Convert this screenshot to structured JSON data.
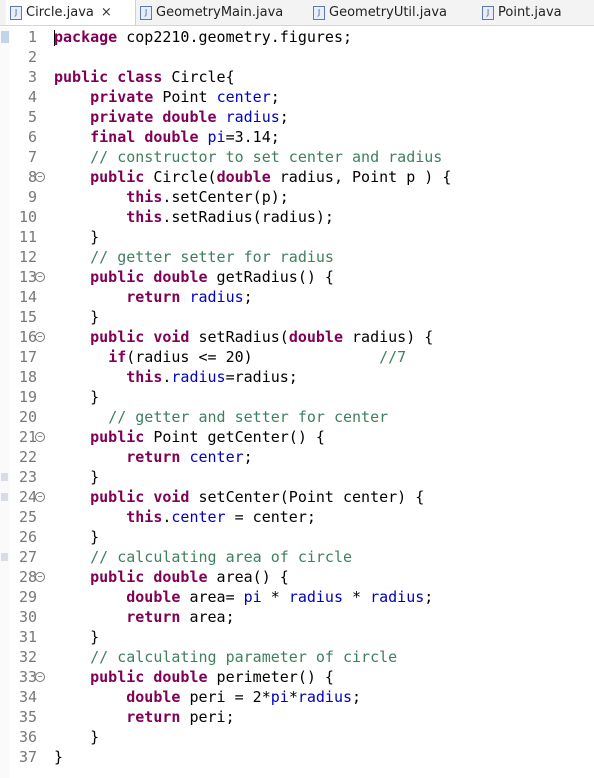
{
  "tabs": [
    {
      "label": "Circle.java",
      "active": true,
      "close": "×",
      "icon": "java-file-icon"
    },
    {
      "label": "GeometryMain.java",
      "active": false,
      "icon": "java-file-icon"
    },
    {
      "label": "GeometryUtil.java",
      "active": false,
      "icon": "java-file-icon"
    },
    {
      "label": "Point.java",
      "active": false,
      "icon": "java-file-icon"
    }
  ],
  "colors": {
    "keyword": "#7f0055",
    "field": "#0000c0",
    "comment": "#3f7f5f",
    "line_number": "#787878"
  },
  "code_lines": [
    {
      "n": "1",
      "fold": false,
      "tokens": [
        {
          "t": "kw",
          "v": "package"
        },
        {
          "t": "",
          "v": " cop2210.geometry.figures;"
        }
      ]
    },
    {
      "n": "2",
      "fold": false,
      "tokens": []
    },
    {
      "n": "3",
      "fold": false,
      "tokens": [
        {
          "t": "kw",
          "v": "public"
        },
        {
          "t": "",
          "v": " "
        },
        {
          "t": "kw",
          "v": "class"
        },
        {
          "t": "",
          "v": " Circle{"
        }
      ]
    },
    {
      "n": "4",
      "fold": false,
      "tokens": [
        {
          "t": "",
          "v": "    "
        },
        {
          "t": "kw",
          "v": "private"
        },
        {
          "t": "",
          "v": " Point "
        },
        {
          "t": "fld",
          "v": "center"
        },
        {
          "t": "",
          "v": ";"
        }
      ]
    },
    {
      "n": "5",
      "fold": false,
      "tokens": [
        {
          "t": "",
          "v": "    "
        },
        {
          "t": "kw",
          "v": "private"
        },
        {
          "t": "",
          "v": " "
        },
        {
          "t": "kw",
          "v": "double"
        },
        {
          "t": "",
          "v": " "
        },
        {
          "t": "fld",
          "v": "radius"
        },
        {
          "t": "",
          "v": ";"
        }
      ]
    },
    {
      "n": "6",
      "fold": false,
      "tokens": [
        {
          "t": "",
          "v": "    "
        },
        {
          "t": "kw",
          "v": "final"
        },
        {
          "t": "",
          "v": " "
        },
        {
          "t": "kw",
          "v": "double"
        },
        {
          "t": "",
          "v": " "
        },
        {
          "t": "fld",
          "v": "pi"
        },
        {
          "t": "",
          "v": "=3.14;"
        }
      ]
    },
    {
      "n": "7",
      "fold": false,
      "tokens": [
        {
          "t": "",
          "v": "    "
        },
        {
          "t": "cm",
          "v": "// constructor to set center and radius"
        }
      ]
    },
    {
      "n": "8",
      "fold": true,
      "tokens": [
        {
          "t": "",
          "v": "    "
        },
        {
          "t": "kw",
          "v": "public"
        },
        {
          "t": "",
          "v": " Circle("
        },
        {
          "t": "kw",
          "v": "double"
        },
        {
          "t": "",
          "v": " radius, Point p ) {"
        }
      ]
    },
    {
      "n": "9",
      "fold": false,
      "tokens": [
        {
          "t": "",
          "v": "        "
        },
        {
          "t": "kw",
          "v": "this"
        },
        {
          "t": "",
          "v": ".setCenter(p);"
        }
      ]
    },
    {
      "n": "10",
      "fold": false,
      "tokens": [
        {
          "t": "",
          "v": "        "
        },
        {
          "t": "kw",
          "v": "this"
        },
        {
          "t": "",
          "v": ".setRadius(radius);"
        }
      ]
    },
    {
      "n": "11",
      "fold": false,
      "tokens": [
        {
          "t": "",
          "v": "    }"
        }
      ]
    },
    {
      "n": "12",
      "fold": false,
      "tokens": [
        {
          "t": "",
          "v": "    "
        },
        {
          "t": "cm",
          "v": "// getter setter for radius"
        }
      ]
    },
    {
      "n": "13",
      "fold": true,
      "tokens": [
        {
          "t": "",
          "v": "    "
        },
        {
          "t": "kw",
          "v": "public"
        },
        {
          "t": "",
          "v": " "
        },
        {
          "t": "kw",
          "v": "double"
        },
        {
          "t": "",
          "v": " getRadius() {"
        }
      ]
    },
    {
      "n": "14",
      "fold": false,
      "tokens": [
        {
          "t": "",
          "v": "        "
        },
        {
          "t": "kw",
          "v": "return"
        },
        {
          "t": "",
          "v": " "
        },
        {
          "t": "fld",
          "v": "radius"
        },
        {
          "t": "",
          "v": ";"
        }
      ]
    },
    {
      "n": "15",
      "fold": false,
      "tokens": [
        {
          "t": "",
          "v": "    }"
        }
      ]
    },
    {
      "n": "16",
      "fold": true,
      "tokens": [
        {
          "t": "",
          "v": "    "
        },
        {
          "t": "kw",
          "v": "public"
        },
        {
          "t": "",
          "v": " "
        },
        {
          "t": "kw",
          "v": "void"
        },
        {
          "t": "",
          "v": " setRadius("
        },
        {
          "t": "kw",
          "v": "double"
        },
        {
          "t": "",
          "v": " radius) {"
        }
      ]
    },
    {
      "n": "17",
      "fold": false,
      "tokens": [
        {
          "t": "",
          "v": "      "
        },
        {
          "t": "kw",
          "v": "if"
        },
        {
          "t": "",
          "v": "(radius <= 20)              "
        },
        {
          "t": "cm",
          "v": "//7"
        }
      ]
    },
    {
      "n": "18",
      "fold": false,
      "tokens": [
        {
          "t": "",
          "v": "        "
        },
        {
          "t": "kw",
          "v": "this"
        },
        {
          "t": "",
          "v": "."
        },
        {
          "t": "fld",
          "v": "radius"
        },
        {
          "t": "",
          "v": "=radius;"
        }
      ]
    },
    {
      "n": "19",
      "fold": false,
      "tokens": [
        {
          "t": "",
          "v": "    }"
        }
      ]
    },
    {
      "n": "20",
      "fold": false,
      "tokens": [
        {
          "t": "",
          "v": "      "
        },
        {
          "t": "cm",
          "v": "// getter and setter for center"
        }
      ]
    },
    {
      "n": "21",
      "fold": true,
      "tokens": [
        {
          "t": "",
          "v": "    "
        },
        {
          "t": "kw",
          "v": "public"
        },
        {
          "t": "",
          "v": " Point getCenter() {"
        }
      ]
    },
    {
      "n": "22",
      "fold": false,
      "tokens": [
        {
          "t": "",
          "v": "        "
        },
        {
          "t": "kw",
          "v": "return"
        },
        {
          "t": "",
          "v": " "
        },
        {
          "t": "fld",
          "v": "center"
        },
        {
          "t": "",
          "v": ";"
        }
      ]
    },
    {
      "n": "23",
      "fold": false,
      "tokens": [
        {
          "t": "",
          "v": "    }"
        }
      ]
    },
    {
      "n": "24",
      "fold": true,
      "tokens": [
        {
          "t": "",
          "v": "    "
        },
        {
          "t": "kw",
          "v": "public"
        },
        {
          "t": "",
          "v": " "
        },
        {
          "t": "kw",
          "v": "void"
        },
        {
          "t": "",
          "v": " setCenter(Point center) {"
        }
      ]
    },
    {
      "n": "25",
      "fold": false,
      "tokens": [
        {
          "t": "",
          "v": "        "
        },
        {
          "t": "kw",
          "v": "this"
        },
        {
          "t": "",
          "v": "."
        },
        {
          "t": "fld",
          "v": "center"
        },
        {
          "t": "",
          "v": " = center;"
        }
      ]
    },
    {
      "n": "26",
      "fold": false,
      "tokens": [
        {
          "t": "",
          "v": "    }"
        }
      ]
    },
    {
      "n": "27",
      "fold": false,
      "tokens": [
        {
          "t": "",
          "v": "    "
        },
        {
          "t": "cm",
          "v": "// calculating area of circle"
        }
      ]
    },
    {
      "n": "28",
      "fold": true,
      "tokens": [
        {
          "t": "",
          "v": "    "
        },
        {
          "t": "kw",
          "v": "public"
        },
        {
          "t": "",
          "v": " "
        },
        {
          "t": "kw",
          "v": "double"
        },
        {
          "t": "",
          "v": " area() {"
        }
      ]
    },
    {
      "n": "29",
      "fold": false,
      "tokens": [
        {
          "t": "",
          "v": "        "
        },
        {
          "t": "kw",
          "v": "double"
        },
        {
          "t": "",
          "v": " area= "
        },
        {
          "t": "fld",
          "v": "pi"
        },
        {
          "t": "",
          "v": " * "
        },
        {
          "t": "fld",
          "v": "radius"
        },
        {
          "t": "",
          "v": " * "
        },
        {
          "t": "fld",
          "v": "radius"
        },
        {
          "t": "",
          "v": ";"
        }
      ]
    },
    {
      "n": "30",
      "fold": false,
      "tokens": [
        {
          "t": "",
          "v": "        "
        },
        {
          "t": "kw",
          "v": "return"
        },
        {
          "t": "",
          "v": " area;"
        }
      ]
    },
    {
      "n": "31",
      "fold": false,
      "tokens": [
        {
          "t": "",
          "v": "    }"
        }
      ]
    },
    {
      "n": "32",
      "fold": false,
      "tokens": [
        {
          "t": "",
          "v": "    "
        },
        {
          "t": "cm",
          "v": "// calculating parameter of circle"
        }
      ]
    },
    {
      "n": "33",
      "fold": true,
      "tokens": [
        {
          "t": "",
          "v": "    "
        },
        {
          "t": "kw",
          "v": "public"
        },
        {
          "t": "",
          "v": " "
        },
        {
          "t": "kw",
          "v": "double"
        },
        {
          "t": "",
          "v": " perimeter() {"
        }
      ]
    },
    {
      "n": "34",
      "fold": false,
      "tokens": [
        {
          "t": "",
          "v": "        "
        },
        {
          "t": "kw",
          "v": "double"
        },
        {
          "t": "",
          "v": " peri = 2*"
        },
        {
          "t": "fld",
          "v": "pi"
        },
        {
          "t": "",
          "v": "*"
        },
        {
          "t": "fld",
          "v": "radius"
        },
        {
          "t": "",
          "v": ";"
        }
      ]
    },
    {
      "n": "35",
      "fold": false,
      "tokens": [
        {
          "t": "",
          "v": "        "
        },
        {
          "t": "kw",
          "v": "return"
        },
        {
          "t": "",
          "v": " peri;"
        }
      ]
    },
    {
      "n": "36",
      "fold": false,
      "tokens": [
        {
          "t": "",
          "v": "    }"
        }
      ]
    },
    {
      "n": "37",
      "fold": false,
      "tokens": [
        {
          "t": "",
          "v": "}"
        }
      ]
    }
  ]
}
